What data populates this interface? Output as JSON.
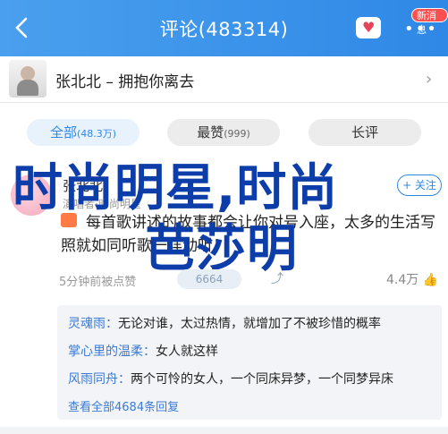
{
  "header": {
    "title": "评论(483314)",
    "badge": "新消息"
  },
  "song": {
    "title": "张北北 – 拥抱你离去"
  },
  "tabs": [
    {
      "label": "全部",
      "count": "(48.3万)"
    },
    {
      "label": "最赞",
      "count": "(999)"
    },
    {
      "label": "长评",
      "count": ""
    }
  ],
  "post": {
    "username": "张北北",
    "subtitle": "演唱者·时尚明星",
    "follow_label": "+ 关注",
    "text": "每首歌讲述的故事都会让你对号入座，太多的生活写照就如同听歌一样动听！",
    "overlay_line1": "时尚明星,时尚",
    "overlay_line2": "芭莎明",
    "time": "5分钟前被点赞",
    "stat_box": "6664",
    "like_count": "4.4万"
  },
  "replies": [
    {
      "who": "灵魂雨：",
      "text": "无论对谁，太过热情，就增加了不被珍惜的概率"
    },
    {
      "who": "掌心里的温柔：",
      "text": "女人就这样"
    },
    {
      "who": "风雨同舟：",
      "text": "两个可怜的女人，一个同床异梦，一个同梦异床"
    }
  ],
  "all_replies": "查看全部4684条回复"
}
